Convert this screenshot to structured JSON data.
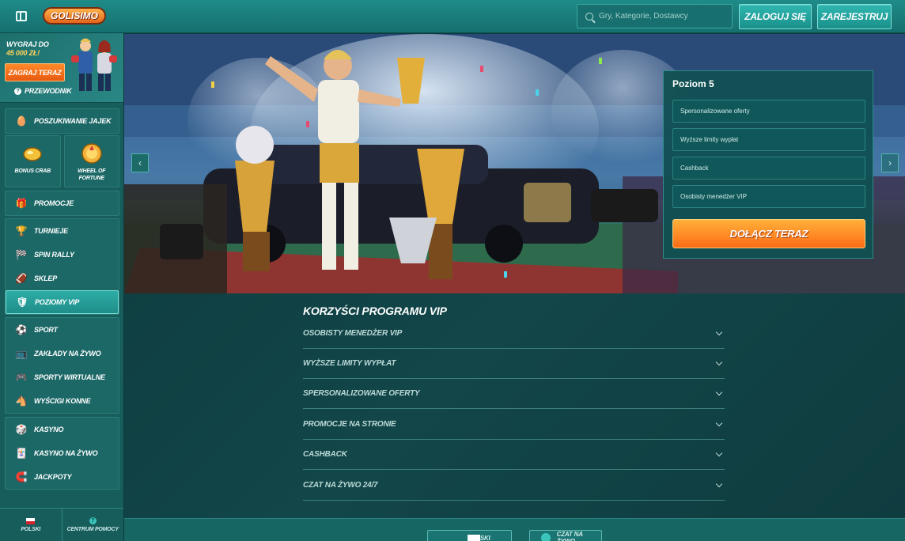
{
  "header": {
    "logo_text": "GOLISIMO",
    "search_placeholder": "Gry, Kategorie, Dostawcy",
    "login_label": "ZALOGUJ SIĘ",
    "register_label": "ZAREJESTRUJ"
  },
  "sidebar": {
    "promo": {
      "line1": "WYGRAJ DO",
      "amount": "45 000 ZŁ!",
      "play_label": "ZAGRAJ TERAZ",
      "guide_label": "PRZEWODNIK"
    },
    "egg_hunt": "POSZUKIWANIE JAJEK",
    "tiles": [
      "BONUS CRAB",
      "WHEEL OF FORTUNE"
    ],
    "promotions": "PROMOCJE",
    "group_vip": [
      "TURNIEJE",
      "SPIN RALLY",
      "SKLEP",
      "POZIOMY VIP"
    ],
    "group_sport": [
      "SPORT",
      "ZAKŁADY NA ŻYWO",
      "SPORTY WIRTUALNE",
      "WYŚCIGI KONNE"
    ],
    "group_casino": [
      "KASYNO",
      "KASYNO NA ŻYWO",
      "JACKPOTY"
    ],
    "footer": {
      "language": "POLSKI",
      "help": "CENTRUM POMOCY"
    },
    "active_item": "POZIOMY VIP"
  },
  "vip_card": {
    "title": "Poziom 5",
    "benefits": [
      "Spersonalizowane oferty",
      "Wyższe limity wypłat",
      "Cashback",
      "Osobisty menedżer VIP"
    ],
    "join_label": "DOŁĄCZ TERAZ"
  },
  "benefits_section": {
    "title": "KORZYŚCI PROGRAMU VIP",
    "items": [
      "OSOBISTY MENEDŻER VIP",
      "WYŻSZE LIMITY WYPŁAT",
      "SPERSONALIZOWANE OFERTY",
      "PROMOCJE NA STRONIE",
      "CASHBACK",
      "CZAT NA ŻYWO 24/7"
    ]
  },
  "bottom": {
    "language_label": "POLSKI",
    "chat_label": "CZAT NA ŻYWO"
  },
  "colors": {
    "accent_teal": "#2dada7",
    "orange_cta": "#ff6c17",
    "background": "#0e3a3d"
  }
}
